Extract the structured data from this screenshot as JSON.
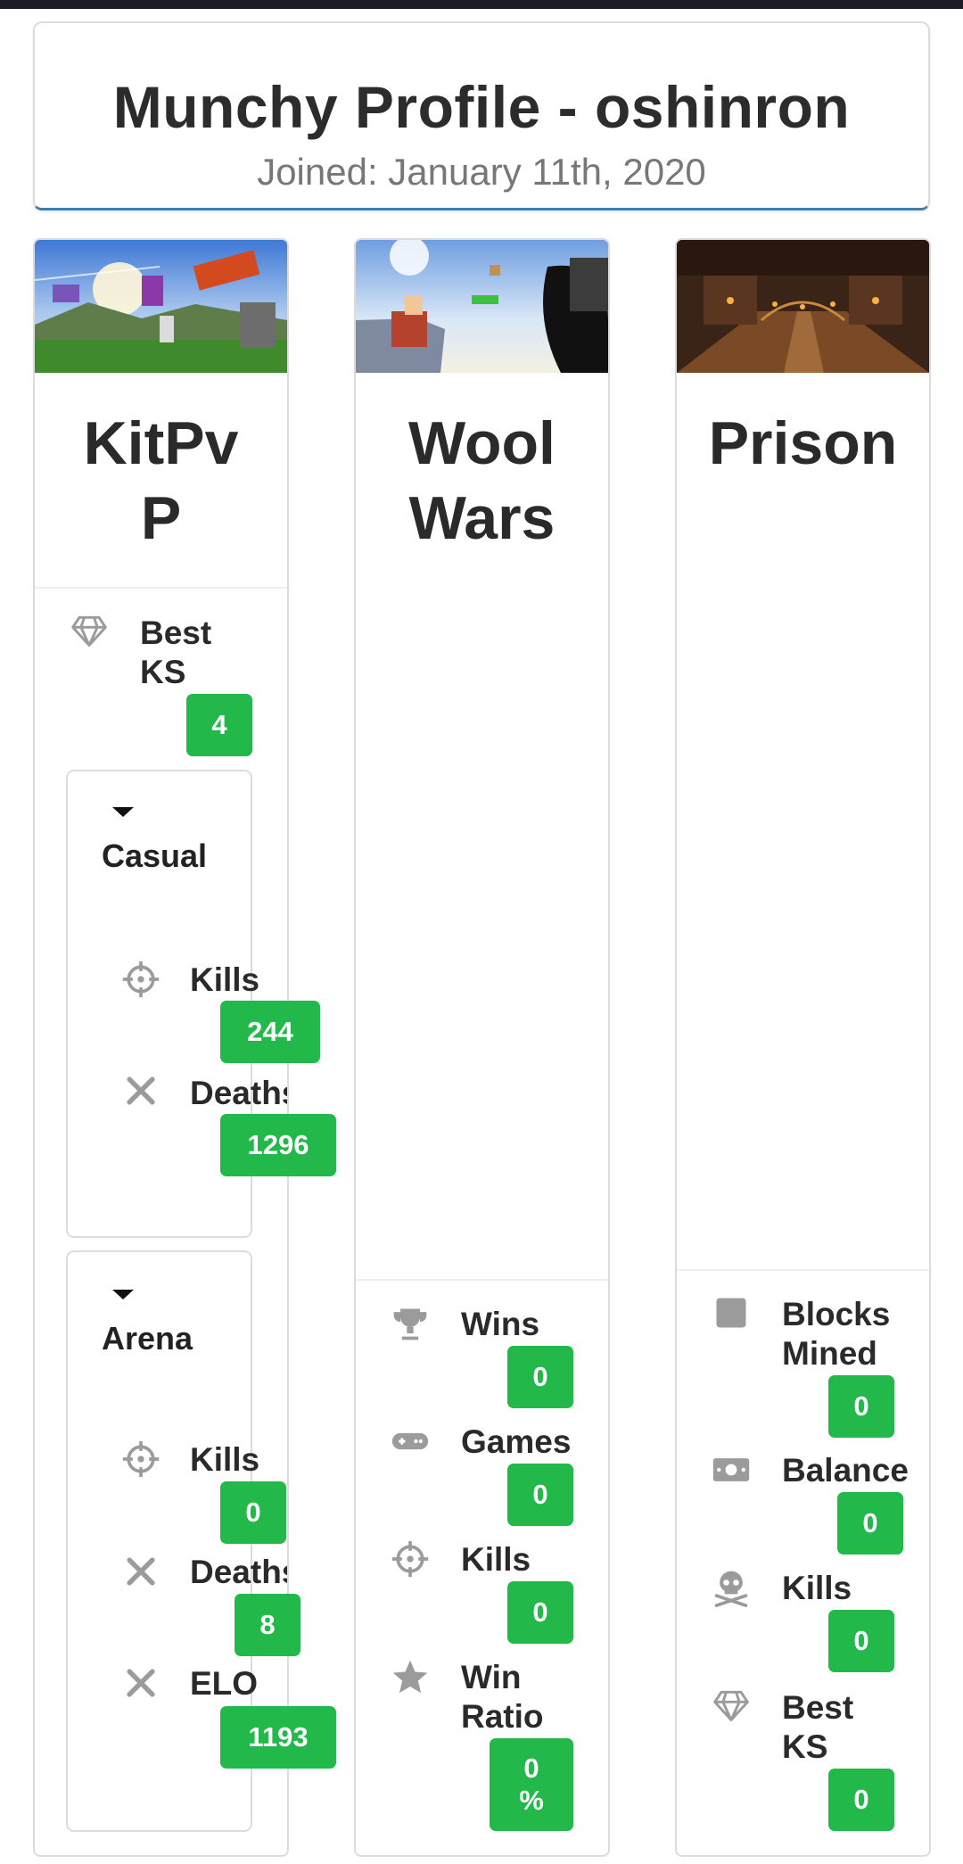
{
  "header": {
    "title": "Munchy Profile - oshinron",
    "joined": "Joined: January 11th, 2020"
  },
  "kitpvp": {
    "title_line1": "KitPv",
    "title_line2": "P",
    "best_ks": {
      "label_line1": "Best",
      "label_line2": "KS",
      "value": "4",
      "icon": "diamond-icon"
    },
    "casual": {
      "title": "Casual",
      "kills": {
        "label": "Kills",
        "value": "244",
        "icon": "crosshair-icon"
      },
      "deaths": {
        "label": "Deaths",
        "value": "1296",
        "icon": "x-icon"
      }
    },
    "arena": {
      "title": "Arena",
      "kills": {
        "label": "Kills",
        "value": "0",
        "icon": "crosshair-icon"
      },
      "deaths": {
        "label": "Deaths",
        "value": "8",
        "icon": "x-icon"
      },
      "elo": {
        "label": "ELO",
        "value": "1193",
        "icon": "x-icon"
      }
    }
  },
  "woolwars": {
    "title_line1": "Wool",
    "title_line2": "Wars",
    "wins": {
      "label": "Wins",
      "value": "0",
      "icon": "trophy-icon"
    },
    "games": {
      "label": "Games",
      "value": "0",
      "icon": "gamepad-icon"
    },
    "kills": {
      "label": "Kills",
      "value": "0",
      "icon": "crosshair-icon"
    },
    "win_ratio": {
      "label_line1": "Win",
      "label_line2": "Ratio",
      "value_line1": "0",
      "value_line2": "%",
      "icon": "star-icon"
    }
  },
  "prison": {
    "title": "Prison",
    "blocks_mined": {
      "label_line1": "Blocks",
      "label_line2": "Mined",
      "value": "0",
      "icon": "square-icon"
    },
    "balance": {
      "label": "Balance",
      "value": "0",
      "icon": "money-icon"
    },
    "kills": {
      "label": "Kills",
      "value": "0",
      "icon": "skull-crossbones-icon"
    },
    "best_ks": {
      "label_line1": "Best",
      "label_line2": "KS",
      "value": "0",
      "icon": "diamond-icon"
    }
  },
  "colors": {
    "badge": "#22b84a",
    "icon": "#9b9b9b",
    "header_underline": "#3f7fb0"
  }
}
